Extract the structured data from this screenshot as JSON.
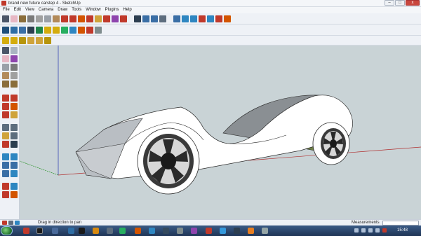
{
  "window": {
    "title": "brand new future carstep 4 - SketchUp"
  },
  "menu": {
    "items": [
      "File",
      "Edit",
      "View",
      "Camera",
      "Draw",
      "Tools",
      "Window",
      "Plugins",
      "Help"
    ]
  },
  "window_controls": {
    "minimize": "–",
    "maximize": "□",
    "close": "x"
  },
  "status": {
    "hint": "Drag in direction to pan",
    "measurements_label": "Measurements",
    "measurements_value": ""
  },
  "taskbar": {
    "clock": "15:48"
  },
  "colors": {
    "viewport_bg": "#c9d3d6",
    "car_body": "#ffffff",
    "car_glass": "#6e7f46",
    "accent_red": "#c0392b"
  },
  "icons": {
    "toolbar": [
      "select-icon",
      "eraser-icon",
      "pencil-icon",
      "line-icon",
      "arc-icon",
      "rectangle-icon",
      "circle-icon",
      "push-pull-icon",
      "move-icon",
      "rotate-icon",
      "scale-icon",
      "offset-icon",
      "tape-icon",
      "paint-icon",
      "orbit-icon",
      "pan-icon",
      "zoom-icon",
      "zoom-extents-icon"
    ],
    "left": [
      "select-icon",
      "component-icon",
      "eraser-icon",
      "paint-bucket-icon",
      "rectangle-icon",
      "line-icon",
      "circle-icon",
      "arc-icon",
      "polygon-icon",
      "freehand-icon",
      "move-icon",
      "push-pull-icon",
      "rotate-icon",
      "follow-me-icon",
      "scale-icon",
      "offset-icon",
      "tape-measure-icon",
      "dimension-icon",
      "protractor-icon",
      "text-icon",
      "axes-icon",
      "3d-text-icon",
      "orbit-icon",
      "pan-icon",
      "zoom-icon",
      "zoom-window-icon",
      "zoom-extents-icon",
      "previous-icon",
      "position-camera-icon",
      "look-around-icon",
      "walk-icon",
      "section-plane-icon"
    ]
  }
}
